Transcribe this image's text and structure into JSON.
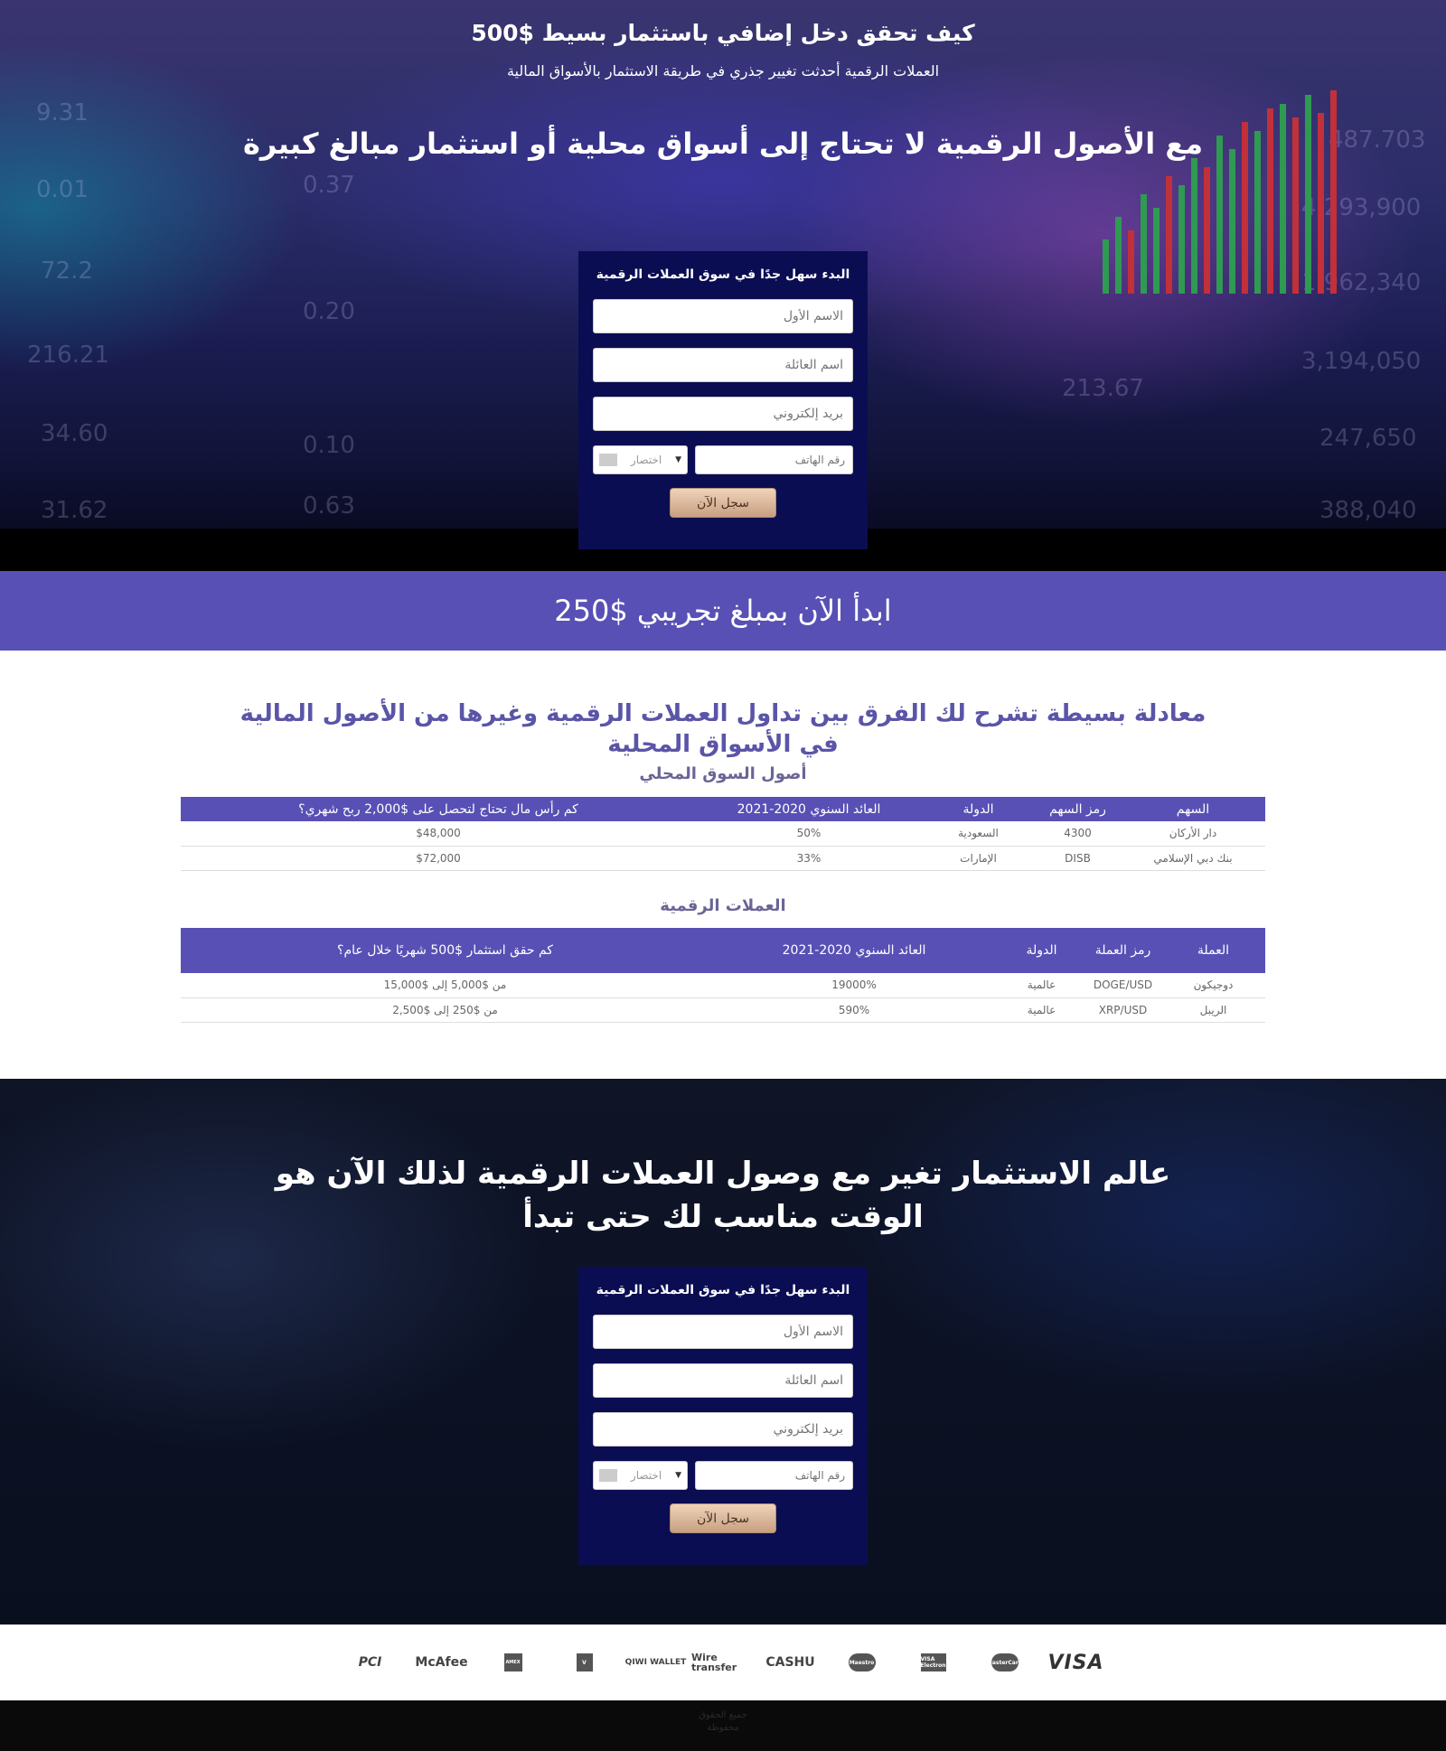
{
  "hero": {
    "title": "كيف تحقق دخل إضافي باستثمار بسيط $500",
    "subtitle": "العملات الرقمية أحدثت تغيير جذري في طريقة الاستثمار بالأسواق المالية",
    "headline": "مع الأصول الرقمية لا تحتاج إلى أسواق محلية أو استثمار مبالغ كبيرة",
    "background_numbers": [
      "9.31",
      "0.01",
      "72.2",
      "216.21",
      "34.60",
      "31.62",
      "0.37",
      "0.20",
      "0.10",
      "0.63",
      "213.67",
      "487.703",
      "4,293,900",
      "1,962,340",
      "3,194,050",
      "247,650",
      "388,040"
    ]
  },
  "form": {
    "title": "البدء سهل جدًا في سوق العملات الرقمية",
    "first_name_placeholder": "الاسم الأول",
    "last_name_placeholder": "اسم العائلة",
    "email_placeholder": "بريد إلكتروني",
    "phone_placeholder": "رقم الهاتف",
    "country_code_label": "اختصار",
    "submit_label": "سجل الآن"
  },
  "banner": {
    "text": "ابدأ الآن بمبلغ تجريبي $250"
  },
  "comparison": {
    "heading": "معادلة بسيطة تشرح لك الفرق بين تداول العملات الرقمية وغيرها من الأصول المالية في الأسواق المحلية",
    "local": {
      "title": "أصول السوق المحلي",
      "headers": [
        "السهم",
        "رمز السهم",
        "الدولة",
        "العائد السنوي 2020-2021",
        "كم رأس مال تحتاج لتحصل على $2,000 ربح شهري؟"
      ],
      "rows": [
        [
          "دار الأركان",
          "4300",
          "السعودية",
          "50%",
          "$48,000"
        ],
        [
          "بنك دبي الإسلامي",
          "DISB",
          "الإمارات",
          "33%",
          "$72,000"
        ]
      ]
    },
    "crypto": {
      "title": "العملات الرقمية",
      "headers": [
        "العملة",
        "رمز العملة",
        "الدولة",
        "العائد السنوي 2020-2021",
        "كم حقق استثمار $500 شهريًا خلال عام؟"
      ],
      "rows": [
        [
          "دوجيكون",
          "DOGE/USD",
          "عالمية",
          "19000%",
          "من $5,000 إلى $15,000"
        ],
        [
          "الريبل",
          "XRP/USD",
          "عالمية",
          "590%",
          "من $250 إلى $2,500"
        ]
      ]
    }
  },
  "cta": {
    "headline": "عالم الاستثمار تغير مع وصول العملات الرقمية لذلك الآن هو الوقت مناسب لك حتى تبدأ"
  },
  "payments": {
    "pci": "PCI",
    "mcafee": "McAfee",
    "amex": "AMEX",
    "verified": "V",
    "qiwi": "QIWI WALLET",
    "wire": "Wire transfer",
    "cashu": "CASHU",
    "maestro": "Maestro",
    "visa_electron": "VISA Electron",
    "mastercard": "MasterCard",
    "visa": "VISA"
  },
  "footer": {
    "text": "جميع الحقوق محفوظة"
  },
  "colors": {
    "accent": "#5850b5",
    "form_bg": "#0b0d52",
    "button": "#d9b396",
    "footer": "#0a0a0a"
  }
}
